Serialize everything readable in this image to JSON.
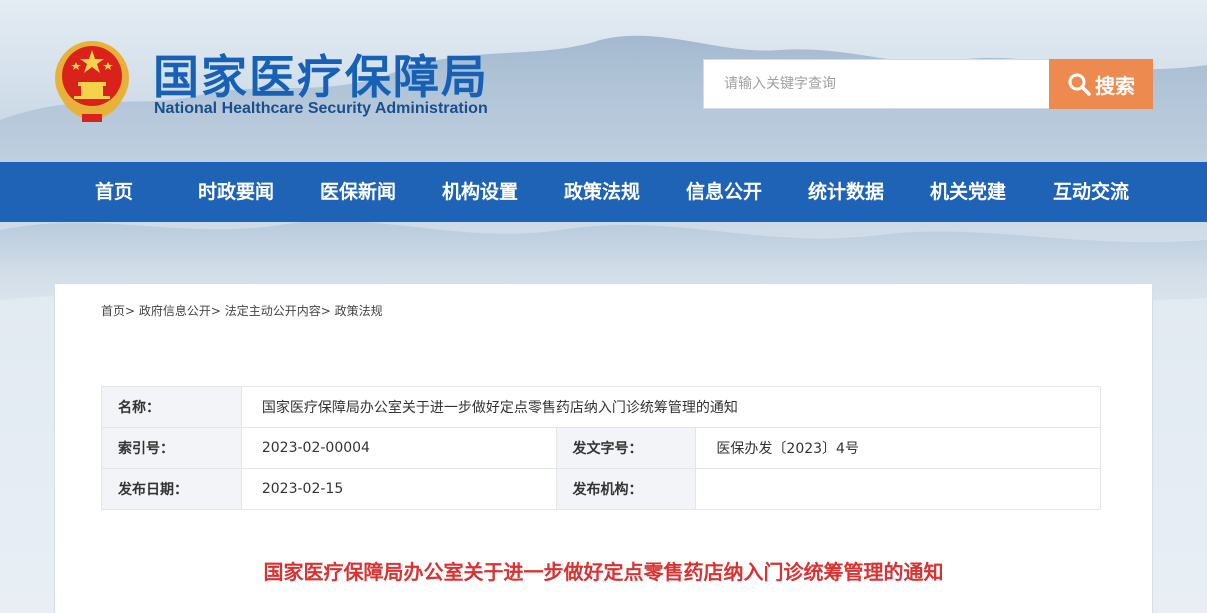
{
  "header": {
    "title": "国家医疗保障局",
    "subtitle": "National Healthcare Security Administration",
    "emblem_icon": "national-emblem-icon"
  },
  "search": {
    "placeholder": "请输入关键字查询",
    "button_label": "搜索",
    "button_color": "#ec8a4f"
  },
  "nav": {
    "color": "#1f63b6",
    "items": [
      "首页",
      "时政要闻",
      "医保新闻",
      "机构设置",
      "政策法规",
      "信息公开",
      "统计数据",
      "机关党建",
      "互动交流"
    ]
  },
  "breadcrumb": [
    "首页>",
    "政府信息公开>",
    "法定主动公开内容>",
    "政策法规"
  ],
  "meta": {
    "name_label": "名称：",
    "name_value": "国家医疗保障局办公室关于进一步做好定点零售药店纳入门诊统筹管理的通知",
    "index_label": "索引号：",
    "index_value": "2023-02-00004",
    "doc_no_label": "发文字号：",
    "doc_no_value": "医保办发〔2023〕4号",
    "date_label": "发布日期：",
    "date_value": "2023-02-15",
    "org_label": "发布机构：",
    "org_value": ""
  },
  "document": {
    "title": "国家医疗保障局办公室关于进一步做好定点零售药店纳入门诊统筹管理的通知",
    "title_color": "#d93232"
  }
}
